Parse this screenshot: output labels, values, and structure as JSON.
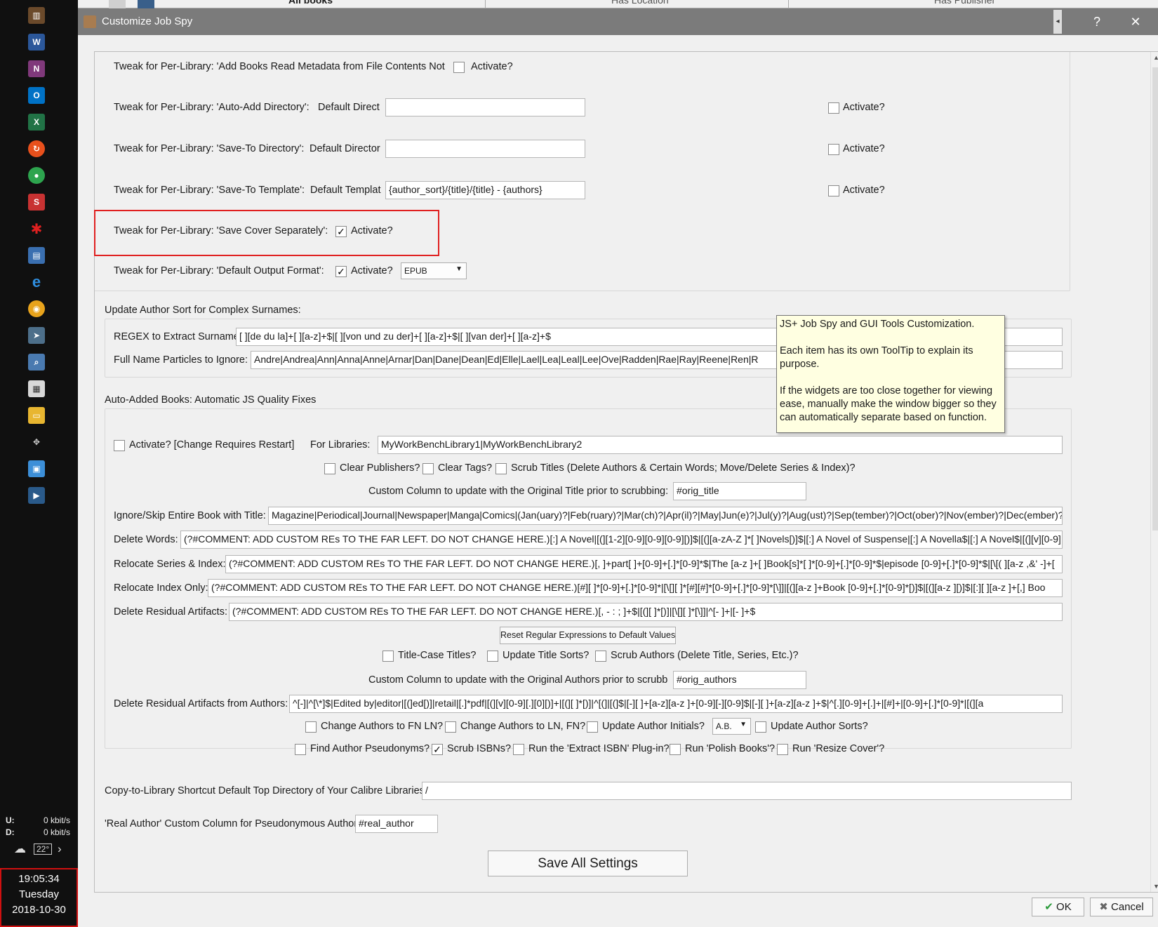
{
  "background_app": {
    "tabs": [
      "All books",
      "Has Location",
      "Has Publisher"
    ]
  },
  "taskbar": {
    "net_up_label": "U:",
    "net_up_value": "0 kbit/s",
    "net_down_label": "D:",
    "net_down_value": "0 kbit/s",
    "tray_temp": "22°",
    "time": "19:05:34",
    "weekday": "Tuesday",
    "date": "2018-10-30"
  },
  "dialog": {
    "title": "Customize Job Spy",
    "help_label": "?",
    "close_label": "✕",
    "ok_label": "OK",
    "cancel_label": "Cancel"
  },
  "tweaks": {
    "t1_label": "Tweak for Per-Library: 'Add Books Read Metadata from File Contents Not Na",
    "t1_activate": "Activate?",
    "t2_label": "Tweak for Per-Library: 'Auto-Add Directory':",
    "t2_default": "Default Direct",
    "t2_value": "",
    "t2_activate": "Activate?",
    "t3_label": "Tweak for Per-Library: 'Save-To Directory':",
    "t3_default": "Default Director",
    "t3_value": "",
    "t3_activate": "Activate?",
    "t4_label": "Tweak for Per-Library: 'Save-To Template':",
    "t4_default": "Default Templat",
    "t4_value": "{author_sort}/{title}/{title} - {authors}",
    "t4_activate": "Activate?",
    "t5_label": "Tweak for Per-Library: 'Save Cover Separately':",
    "t5_activate": "Activate?",
    "t6_label": "Tweak for Per-Library: 'Default Output Format':",
    "t6_activate": "Activate?",
    "t6_format": "EPUB",
    "checkmark": "✓"
  },
  "author_sort": {
    "group_title": "Update Author Sort for Complex Surnames:",
    "regex_label": "REGEX to Extract Surname:",
    "regex_value": "[ ][de du la]+[ ][a-z]+$|[ ][von und zu der]+[ ][a-z]+$|[ ][van der]+[ ][a-z]+$",
    "particles_label": "Full Name Particles to Ignore:",
    "particles_value": "Andre|Andrea|Ann|Anna|Anne|Arnar|Dan|Dane|Dean|Ed|Elle|Lael|Lea|Leal|Lee|Ove|Radden|Rae|Ray|Reene|Ren|R"
  },
  "tooltip": {
    "line1": "JS+ Job Spy and GUI Tools Customization.",
    "line2": "Each item has its own ToolTip to explain its purpose.",
    "line3": "If the widgets are too close together for viewing ease, manually make the window bigger so they can automatically separate based on function."
  },
  "quality": {
    "group_title": "Auto-Added Books: Automatic JS Quality Fixes",
    "activate_label": "Activate?  [Change Requires Restart]",
    "libraries_label": "For Libraries:",
    "libraries_value": "MyWorkBenchLibrary1|MyWorkBenchLibrary2",
    "clear_publishers": "Clear Publishers?",
    "clear_tags": "Clear Tags?",
    "scrub_titles": "Scrub Titles (Delete Authors & Certain Words; Move/Delete Series & Index)?",
    "orig_title_label": "Custom Column to update with the Original Title prior to scrubbing:",
    "orig_title_value": "#orig_title",
    "ignore_label": "Ignore/Skip Entire Book with Title:",
    "ignore_value": "Magazine|Periodical|Journal|Newspaper|Manga|Comics|(Jan(uary)?|Feb(ruary)?|Mar(ch)?|Apr(il)?|May|Jun(e)?|Jul(y)?|Aug(ust)?|Sep(tember)?|Oct(ober)?|Nov(ember)?|Dec(ember)?)",
    "delete_words_label": "Delete Words:",
    "delete_words_value": "(?#COMMENT: ADD CUSTOM REs TO THE FAR LEFT. DO NOT CHANGE HERE.)[:] A Novel|[(][1-2][0-9][0-9][0-9][)]$|[(][a-zA-Z ]*[ ]Novels[)]$|[:] A Novel of Suspense|[:] A Novella$|[:] A Novel$|[(][v][0-9]",
    "relocate_series_label": "Relocate Series & Index:",
    "relocate_series_value": "(?#COMMENT: ADD CUSTOM REs TO THE FAR LEFT. DO NOT CHANGE HERE.)[, ]+part[ ]+[0-9]+[.]*[0-9]*$|The [a-z ]+[ ]Book[s]*[ ]*[0-9]+[.]*[0-9]*$|episode [0-9]+[.]*[0-9]*$|[\\[( ][a-z ,&' -]+[",
    "relocate_index_label": "Relocate Index Only:",
    "relocate_index_value": "(?#COMMENT: ADD CUSTOM REs TO THE FAR LEFT. DO NOT CHANGE HERE.)[#][ ]*[0-9]+[.]*[0-9]*|[\\[][ ]*[#][#]*[0-9]+[.]*[0-9]*[\\]]|[(][a-z ]+Book [0-9]+[.]*[0-9]*[)]$|[(][a-z ][)]$|[:][ ][a-z ]+[,] Boo",
    "residual_label": "Delete Residual Artifacts:",
    "residual_value": "(?#COMMENT: ADD CUSTOM REs TO THE FAR LEFT. DO NOT CHANGE HERE.)[, - : ; ]+$|[(][ ]*[)]|[\\[][ ]*[\\]]|^[- ]+|[- ]+$",
    "reset_button": "Reset Regular Expressions to Default Values",
    "title_case": "Title-Case Titles?",
    "update_title_sorts": "Update Title Sorts?",
    "scrub_authors": "Scrub Authors (Delete Title, Series, Etc.)?",
    "orig_authors_label": "Custom Column to update with the Original Authors prior to scrubbi",
    "orig_authors_value": "#orig_authors",
    "residual_authors_label": "Delete Residual Artifacts from Authors:",
    "residual_authors_value": "^[-]|^[\\*]$|Edited by|editor|[(]ed[)]|retail|[.]*pdf|[(][v][0-9][.][0][)]+|[(][ ]*[)]|^[(]|[(]$|[-][ ]+[a-z][a-z ]+[0-9][-][0-9]$|[-][ ]+[a-z][a-z ]+$|^[.][0-9]+[.]+|[#]+|[0-9]+[.]*[0-9]*|[(][a",
    "fn_ln": "Change Authors to FN LN?",
    "ln_fn": "Change Authors to LN, FN?",
    "author_initials": "Update Author Initials?",
    "initials_format": "A.B.",
    "author_sorts": "Update Author Sorts?",
    "pseudonyms": "Find Author Pseudonyms?",
    "scrub_isbns": "Scrub ISBNs?",
    "extract_isbn": "Run the 'Extract ISBN' Plug-in?",
    "polish_books": "Run 'Polish Books'?",
    "resize_cover": "Run 'Resize Cover'?"
  },
  "copy_to_library": {
    "label": "Copy-to-Library Shortcut Default Top Directory of Your Calibre Libraries:",
    "value": "/"
  },
  "real_author": {
    "label": "'Real Author' Custom Column for Pseudonymous Authors",
    "value": "#real_author"
  },
  "save_all_label": "Save All Settings"
}
